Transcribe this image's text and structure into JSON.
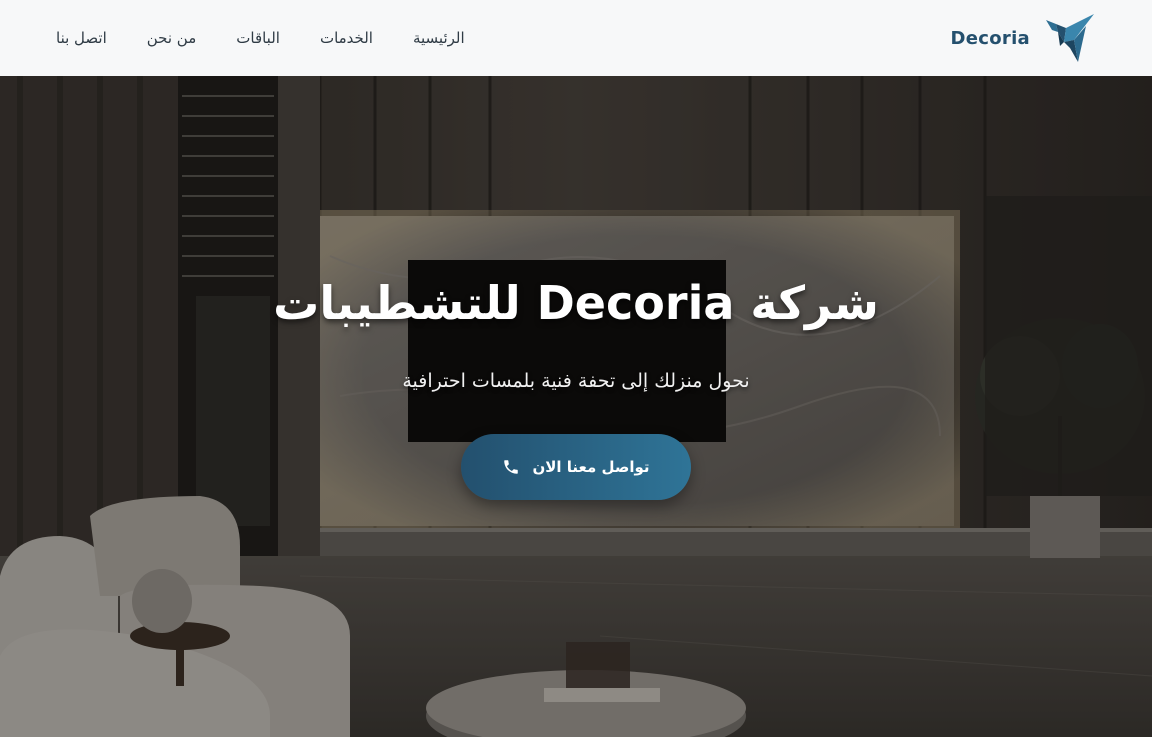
{
  "header": {
    "brand_name": "Decoria",
    "nav": [
      {
        "label": "اتصل بنا"
      },
      {
        "label": "من نحن"
      },
      {
        "label": "الباقات"
      },
      {
        "label": "الخدمات"
      },
      {
        "label": "الرئيسية"
      }
    ]
  },
  "hero": {
    "title": "شركة Decoria للتشطيبات",
    "subtitle": "نحول منزلك إلى تحفة فنية بلمسات احترافية",
    "cta_label": "تواصل معنا الان",
    "cta_icon": "phone-icon"
  },
  "colors": {
    "brand": "#24506e",
    "accent": "#2f7497",
    "header_bg": "#f7f8f9",
    "nav_text": "#2f3b45"
  }
}
